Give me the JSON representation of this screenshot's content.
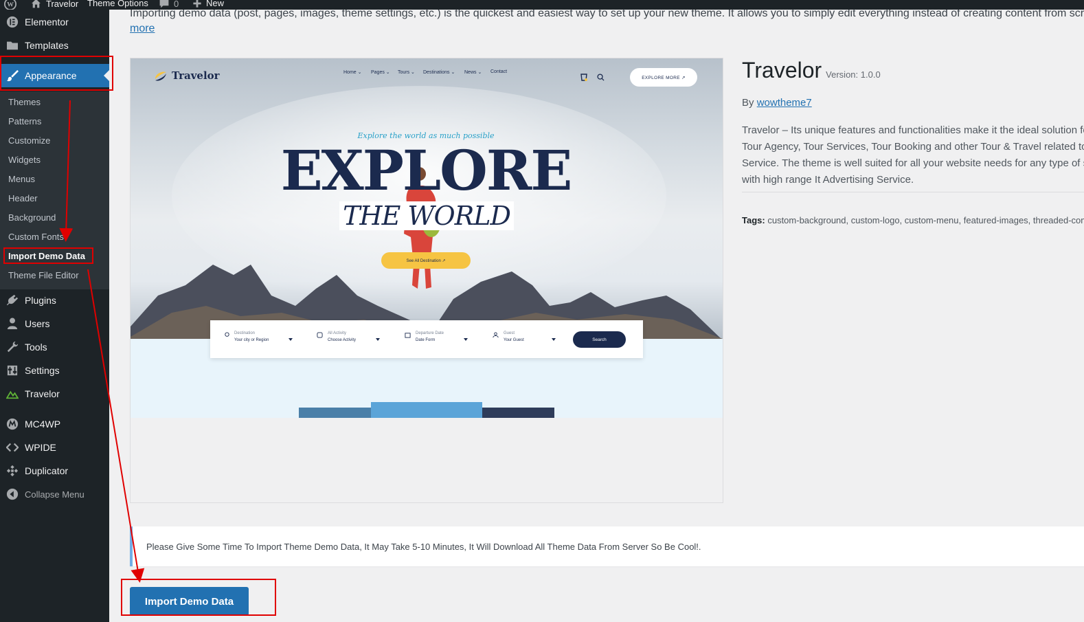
{
  "adminbar": {
    "site_name": "Travelor",
    "theme_options": "Theme Options",
    "comments_count": "0",
    "new_label": "New",
    "icons": [
      "wordpress-icon",
      "home-icon",
      "comment-icon",
      "plus-icon"
    ]
  },
  "sidebar": {
    "items_top": [
      {
        "label": "Elementor",
        "icon": "elementor-icon"
      },
      {
        "label": "Templates",
        "icon": "folder-icon"
      },
      {
        "label": "Appearance",
        "icon": "brush-icon",
        "current": true
      }
    ],
    "submenu": [
      "Themes",
      "Patterns",
      "Customize",
      "Widgets",
      "Menus",
      "Header",
      "Background",
      "Custom Fonts",
      "Import Demo Data",
      "Theme File Editor"
    ],
    "submenu_current": "Import Demo Data",
    "items_bottom": [
      {
        "label": "Plugins",
        "icon": "plug-icon"
      },
      {
        "label": "Users",
        "icon": "user-icon"
      },
      {
        "label": "Tools",
        "icon": "wrench-icon"
      },
      {
        "label": "Settings",
        "icon": "settings-icon"
      },
      {
        "label": "Travelor",
        "icon": "travelor-icon"
      },
      {
        "label": "MC4WP",
        "icon": "mc4wp-icon"
      },
      {
        "label": "WPIDE",
        "icon": "code-icon"
      },
      {
        "label": "Duplicator",
        "icon": "duplicator-icon"
      }
    ],
    "collapse_label": "Collapse Menu"
  },
  "content": {
    "intro_text": "Importing demo data (post, pages, images, theme settings, etc.) is the quickest and easiest way to set up your new theme. It allows you to simply edit everything instead of creating content from scratch.",
    "more_link": "more",
    "screenshot": {
      "logo": "Travelor",
      "nav": [
        "Home ⌄",
        "Pages ⌄",
        "Tours ⌄",
        "Destinations ⌄",
        "News ⌄",
        "Contact"
      ],
      "cta": "EXPLORE MORE ↗",
      "tagline": "Explore the world as much possible",
      "headline": "EXPLORE",
      "subheadline": "THE WORLD",
      "see_button": "See All Destination ↗",
      "search_fields": [
        {
          "label": "Destination",
          "value": "Your city or Region"
        },
        {
          "label": "All Activity",
          "value": "Choose Activity"
        },
        {
          "label": "Departure Date",
          "value": "Date Form"
        },
        {
          "label": "Guest",
          "value": "Your Guest"
        }
      ],
      "search_button": "Search"
    },
    "theme": {
      "name": "Travelor",
      "version": "Version: 1.0.0",
      "by": "By",
      "author": "wowtheme7",
      "description": "Travelor – Its unique features and functionalities make it the ideal solution for Tour Agency, Tour Services, Tour Booking and other Tour & Travel related to Service. The theme is well suited for all your website needs for any type of site with high range It Advertising Service.",
      "tags_label": "Tags:",
      "tags": "custom-background, custom-logo, custom-menu, featured-images, threaded-comments"
    },
    "notice": "Please Give Some Time To Import Theme Demo Data, It May Take 5-10 Minutes, It Will Download All Theme Data From Server So Be Cool!.",
    "import_button": "Import Demo Data"
  },
  "colors": {
    "admin_dark": "#1d2327",
    "submenu_bg": "#2c3338",
    "accent_blue": "#2271b1",
    "annotation_red": "#e00000",
    "notice_border": "#72aee6"
  }
}
